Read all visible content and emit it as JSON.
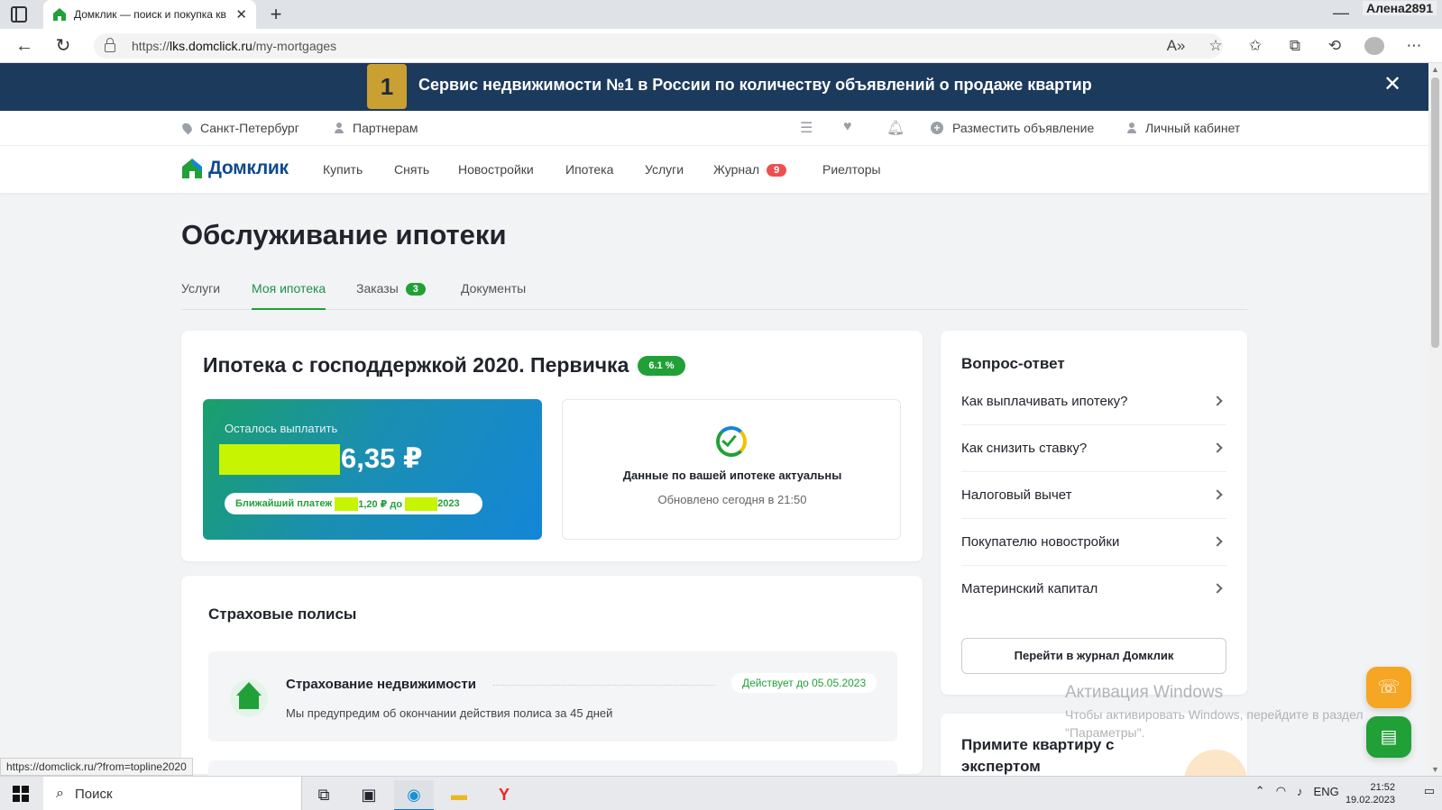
{
  "browser": {
    "tab_title": "Домклик — поиск и покупка кв",
    "url_prefix": "https://",
    "url_host": "lks.domclick.ru",
    "url_path": "/my-mortgages",
    "user_label": "Алена2891",
    "status_url": "https://domclick.ru/?from=topline2020"
  },
  "promo": {
    "badge": "1",
    "text": "Сервис недвижимости №1 в России по количеству объявлений о продаже квартир"
  },
  "topline": {
    "city": "Санкт-Петербург",
    "partners": "Партнерам",
    "post_ad": "Разместить объявление",
    "cabinet": "Личный кабинет"
  },
  "nav": {
    "logo": "Домклик",
    "items": [
      "Купить",
      "Снять",
      "Новостройки",
      "Ипотека",
      "Услуги",
      "Журнал",
      "Риелторы"
    ],
    "journal_badge": "9"
  },
  "page": {
    "title": "Обслуживание ипотеки",
    "tabs": [
      "Услуги",
      "Моя ипотека",
      "Заказы",
      "Документы"
    ],
    "orders_badge": "3",
    "active_tab": "Моя ипотека"
  },
  "mortgage": {
    "title": "Ипотека с господдержкой 2020. Первичка",
    "rate": "6.1 %",
    "remaining_label": "Осталось выплатить",
    "remaining_amount_visible": "6,35 ₽",
    "payment_prefix": "Ближайший платеж",
    "payment_amount_visible": "1,20 ₽ до",
    "payment_date_visible": "2023",
    "status_title": "Данные по вашей ипотеке актуальны",
    "status_sub": "Обновлено сегодня в 21:50"
  },
  "insurance": {
    "section_title": "Страховые полисы",
    "name": "Страхование недвижимости",
    "valid": "Действует до 05.05.2023",
    "desc": "Мы предупредим об окончании действия полиса за 45 дней"
  },
  "faq": {
    "title": "Вопрос-ответ",
    "items": [
      "Как выплачивать ипотеку?",
      "Как снизить ставку?",
      "Налоговый вычет",
      "Покупателю новостройки",
      "Материнский капитал"
    ],
    "button": "Перейти в журнал Домклик"
  },
  "expert": {
    "title": "Примите квартиру с экспертом"
  },
  "watermark": {
    "title": "Активация Windows",
    "sub": "Чтобы активировать Windows, перейдите в раздел \"Параметры\"."
  },
  "taskbar": {
    "search_placeholder": "Поиск",
    "lang": "ENG",
    "time": "21:52",
    "date": "19.02.2023"
  },
  "colors": {
    "brand_green": "#21a038",
    "brand_blue": "#0e4a8f",
    "promo_bg": "#1c3a5c",
    "badge_red": "#ee4f4f",
    "mask_yellow": "#c7f400"
  }
}
